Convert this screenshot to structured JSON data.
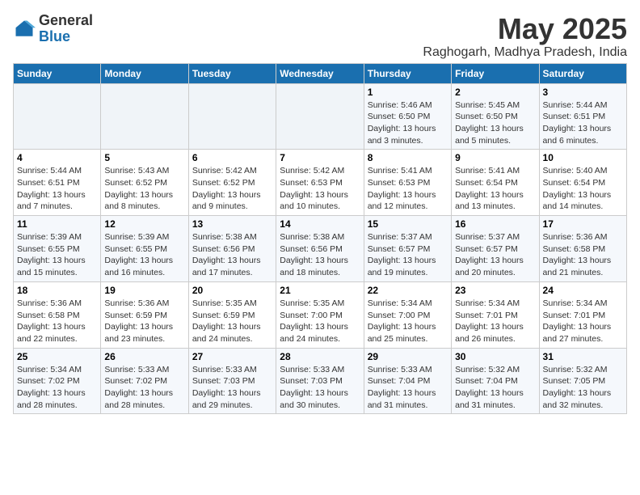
{
  "header": {
    "logo_general": "General",
    "logo_blue": "Blue",
    "month_title": "May 2025",
    "location": "Raghogarh, Madhya Pradesh, India"
  },
  "days_of_week": [
    "Sunday",
    "Monday",
    "Tuesday",
    "Wednesday",
    "Thursday",
    "Friday",
    "Saturday"
  ],
  "weeks": [
    [
      {
        "day": "",
        "info": ""
      },
      {
        "day": "",
        "info": ""
      },
      {
        "day": "",
        "info": ""
      },
      {
        "day": "",
        "info": ""
      },
      {
        "day": "1",
        "sunrise": "5:46 AM",
        "sunset": "6:50 PM",
        "daylight": "13 hours and 3 minutes."
      },
      {
        "day": "2",
        "sunrise": "5:45 AM",
        "sunset": "6:50 PM",
        "daylight": "13 hours and 5 minutes."
      },
      {
        "day": "3",
        "sunrise": "5:44 AM",
        "sunset": "6:51 PM",
        "daylight": "13 hours and 6 minutes."
      }
    ],
    [
      {
        "day": "4",
        "sunrise": "5:44 AM",
        "sunset": "6:51 PM",
        "daylight": "13 hours and 7 minutes."
      },
      {
        "day": "5",
        "sunrise": "5:43 AM",
        "sunset": "6:52 PM",
        "daylight": "13 hours and 8 minutes."
      },
      {
        "day": "6",
        "sunrise": "5:42 AM",
        "sunset": "6:52 PM",
        "daylight": "13 hours and 9 minutes."
      },
      {
        "day": "7",
        "sunrise": "5:42 AM",
        "sunset": "6:53 PM",
        "daylight": "13 hours and 10 minutes."
      },
      {
        "day": "8",
        "sunrise": "5:41 AM",
        "sunset": "6:53 PM",
        "daylight": "13 hours and 12 minutes."
      },
      {
        "day": "9",
        "sunrise": "5:41 AM",
        "sunset": "6:54 PM",
        "daylight": "13 hours and 13 minutes."
      },
      {
        "day": "10",
        "sunrise": "5:40 AM",
        "sunset": "6:54 PM",
        "daylight": "13 hours and 14 minutes."
      }
    ],
    [
      {
        "day": "11",
        "sunrise": "5:39 AM",
        "sunset": "6:55 PM",
        "daylight": "13 hours and 15 minutes."
      },
      {
        "day": "12",
        "sunrise": "5:39 AM",
        "sunset": "6:55 PM",
        "daylight": "13 hours and 16 minutes."
      },
      {
        "day": "13",
        "sunrise": "5:38 AM",
        "sunset": "6:56 PM",
        "daylight": "13 hours and 17 minutes."
      },
      {
        "day": "14",
        "sunrise": "5:38 AM",
        "sunset": "6:56 PM",
        "daylight": "13 hours and 18 minutes."
      },
      {
        "day": "15",
        "sunrise": "5:37 AM",
        "sunset": "6:57 PM",
        "daylight": "13 hours and 19 minutes."
      },
      {
        "day": "16",
        "sunrise": "5:37 AM",
        "sunset": "6:57 PM",
        "daylight": "13 hours and 20 minutes."
      },
      {
        "day": "17",
        "sunrise": "5:36 AM",
        "sunset": "6:58 PM",
        "daylight": "13 hours and 21 minutes."
      }
    ],
    [
      {
        "day": "18",
        "sunrise": "5:36 AM",
        "sunset": "6:58 PM",
        "daylight": "13 hours and 22 minutes."
      },
      {
        "day": "19",
        "sunrise": "5:36 AM",
        "sunset": "6:59 PM",
        "daylight": "13 hours and 23 minutes."
      },
      {
        "day": "20",
        "sunrise": "5:35 AM",
        "sunset": "6:59 PM",
        "daylight": "13 hours and 24 minutes."
      },
      {
        "day": "21",
        "sunrise": "5:35 AM",
        "sunset": "7:00 PM",
        "daylight": "13 hours and 24 minutes."
      },
      {
        "day": "22",
        "sunrise": "5:34 AM",
        "sunset": "7:00 PM",
        "daylight": "13 hours and 25 minutes."
      },
      {
        "day": "23",
        "sunrise": "5:34 AM",
        "sunset": "7:01 PM",
        "daylight": "13 hours and 26 minutes."
      },
      {
        "day": "24",
        "sunrise": "5:34 AM",
        "sunset": "7:01 PM",
        "daylight": "13 hours and 27 minutes."
      }
    ],
    [
      {
        "day": "25",
        "sunrise": "5:34 AM",
        "sunset": "7:02 PM",
        "daylight": "13 hours and 28 minutes."
      },
      {
        "day": "26",
        "sunrise": "5:33 AM",
        "sunset": "7:02 PM",
        "daylight": "13 hours and 28 minutes."
      },
      {
        "day": "27",
        "sunrise": "5:33 AM",
        "sunset": "7:03 PM",
        "daylight": "13 hours and 29 minutes."
      },
      {
        "day": "28",
        "sunrise": "5:33 AM",
        "sunset": "7:03 PM",
        "daylight": "13 hours and 30 minutes."
      },
      {
        "day": "29",
        "sunrise": "5:33 AM",
        "sunset": "7:04 PM",
        "daylight": "13 hours and 31 minutes."
      },
      {
        "day": "30",
        "sunrise": "5:32 AM",
        "sunset": "7:04 PM",
        "daylight": "13 hours and 31 minutes."
      },
      {
        "day": "31",
        "sunrise": "5:32 AM",
        "sunset": "7:05 PM",
        "daylight": "13 hours and 32 minutes."
      }
    ]
  ]
}
